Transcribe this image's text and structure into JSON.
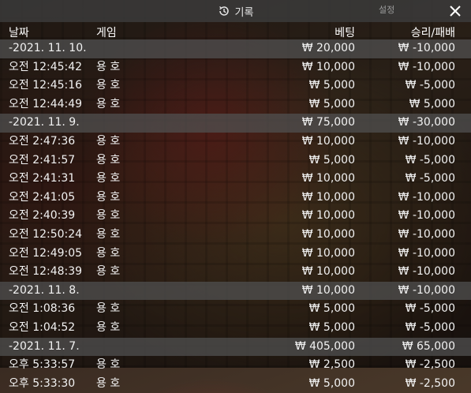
{
  "header": {
    "title": "기록",
    "settings": "설정",
    "close_label": "✕"
  },
  "columns": {
    "date": "날짜",
    "game": "게임",
    "bet": "베팅",
    "result": "승리/패배"
  },
  "rows": [
    {
      "type": "date",
      "date": "-2021. 11. 10.",
      "game": "",
      "bet": "₩ 20,000",
      "result": "₩ -10,000"
    },
    {
      "type": "entry",
      "date": "오전 12:45:42",
      "game": "용 호",
      "bet": "₩ 10,000",
      "result": "₩ -10,000"
    },
    {
      "type": "entry",
      "date": "오전 12:45:16",
      "game": "용 호",
      "bet": "₩ 5,000",
      "result": "₩ -5,000"
    },
    {
      "type": "entry",
      "date": "오전 12:44:49",
      "game": "용 호",
      "bet": "₩ 5,000",
      "result": "₩ 5,000"
    },
    {
      "type": "date",
      "date": "-2021. 11. 9.",
      "game": "",
      "bet": "₩ 75,000",
      "result": "₩ -30,000"
    },
    {
      "type": "entry",
      "date": "오전 2:47:36",
      "game": "용 호",
      "bet": "₩ 10,000",
      "result": "₩ -10,000"
    },
    {
      "type": "entry",
      "date": "오전 2:41:57",
      "game": "용 호",
      "bet": "₩ 5,000",
      "result": "₩ -5,000"
    },
    {
      "type": "entry",
      "date": "오전 2:41:31",
      "game": "용 호",
      "bet": "₩ 10,000",
      "result": "₩ -5,000"
    },
    {
      "type": "entry",
      "date": "오전 2:41:05",
      "game": "용 호",
      "bet": "₩ 10,000",
      "result": "₩ -10,000"
    },
    {
      "type": "entry",
      "date": "오전 2:40:39",
      "game": "용 호",
      "bet": "₩ 10,000",
      "result": "₩ -10,000"
    },
    {
      "type": "entry",
      "date": "오전 12:50:24",
      "game": "용 호",
      "bet": "₩ 10,000",
      "result": "₩ -10,000"
    },
    {
      "type": "entry",
      "date": "오전 12:49:05",
      "game": "용 호",
      "bet": "₩ 10,000",
      "result": "₩ -10,000"
    },
    {
      "type": "entry",
      "date": "오전 12:48:39",
      "game": "용 호",
      "bet": "₩ 10,000",
      "result": "₩ -10,000"
    },
    {
      "type": "date",
      "date": "-2021. 11. 8.",
      "game": "",
      "bet": "₩ 10,000",
      "result": "₩ -10,000"
    },
    {
      "type": "entry",
      "date": "오전 1:08:36",
      "game": "용 호",
      "bet": "₩ 5,000",
      "result": "₩ -5,000"
    },
    {
      "type": "entry",
      "date": "오전 1:04:52",
      "game": "용 호",
      "bet": "₩ 5,000",
      "result": "₩ -5,000"
    },
    {
      "type": "date",
      "date": "-2021. 11. 7.",
      "game": "",
      "bet": "₩ 405,000",
      "result": "₩ 65,000"
    },
    {
      "type": "entry",
      "date": "오후 5:33:57",
      "game": "용 호",
      "bet": "₩ 2,500",
      "result": "₩ -2,500"
    },
    {
      "type": "entry",
      "date": "오후 5:33:30",
      "game": "용 호",
      "bet": "₩ 5,000",
      "result": "₩ -2,500"
    }
  ],
  "icons": {
    "history": "history-clock-icon",
    "close": "close-icon"
  }
}
